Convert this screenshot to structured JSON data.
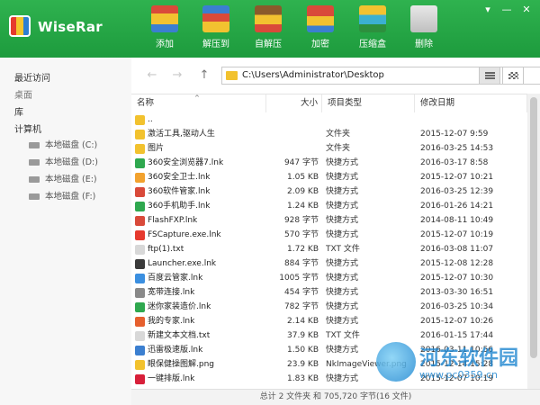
{
  "app": {
    "name": "WiseRar"
  },
  "toolbar": [
    {
      "label": "添加",
      "icon": "add-archive-icon"
    },
    {
      "label": "解压到",
      "icon": "extract-to-icon"
    },
    {
      "label": "自解压",
      "icon": "sfx-exe-icon"
    },
    {
      "label": "加密",
      "icon": "encrypt-icon"
    },
    {
      "label": "压缩盒",
      "icon": "archive-box-icon"
    },
    {
      "label": "删除",
      "icon": "trash-icon"
    }
  ],
  "window": {
    "menu": "▾",
    "minimize": "—",
    "close": "✕"
  },
  "sidebar": {
    "sections": [
      "最近访问",
      "桌面",
      "库",
      "计算机"
    ],
    "disks": [
      "本地磁盘 (C:)",
      "本地磁盘 (D:)",
      "本地磁盘 (E:)",
      "本地磁盘 (F:)"
    ]
  },
  "nav": {
    "back": "←",
    "forward": "→",
    "up": "↑",
    "path": "C:\\Users\\Administrator\\Desktop",
    "dropdown": "▼"
  },
  "columns": [
    "名称",
    "大小",
    "项目类型",
    "修改日期"
  ],
  "sort_arrow": "^",
  "files": [
    {
      "name": "..",
      "size": "",
      "type": "",
      "date": "",
      "color": "#f2c22e"
    },
    {
      "name": "激活工具,驱动人生",
      "size": "",
      "type": "文件夹",
      "date": "2015-12-07 9:59",
      "color": "#f2c22e"
    },
    {
      "name": "图片",
      "size": "",
      "type": "文件夹",
      "date": "2016-03-25 14:53",
      "color": "#f2c22e"
    },
    {
      "name": "360安全浏览器7.lnk",
      "size": "947 字节",
      "type": "快捷方式",
      "date": "2016-03-17 8:58",
      "color": "#2fa84f"
    },
    {
      "name": "360安全卫士.lnk",
      "size": "1.05 KB",
      "type": "快捷方式",
      "date": "2015-12-07 10:21",
      "color": "#f2a22e"
    },
    {
      "name": "360软件管家.lnk",
      "size": "2.09 KB",
      "type": "快捷方式",
      "date": "2016-03-25 12:39",
      "color": "#d94a3a"
    },
    {
      "name": "360手机助手.lnk",
      "size": "1.24 KB",
      "type": "快捷方式",
      "date": "2016-01-26 14:21",
      "color": "#2fa84f"
    },
    {
      "name": "FlashFXP.lnk",
      "size": "928 字节",
      "type": "快捷方式",
      "date": "2014-08-11 10:49",
      "color": "#d94a3a"
    },
    {
      "name": "FSCapture.exe.lnk",
      "size": "570 字节",
      "type": "快捷方式",
      "date": "2015-12-07 10:19",
      "color": "#e63a2e"
    },
    {
      "name": "ftp(1).txt",
      "size": "1.72 KB",
      "type": "TXT 文件",
      "date": "2016-03-08 11:07",
      "color": "#d8d8d8"
    },
    {
      "name": "Launcher.exe.lnk",
      "size": "884 字节",
      "type": "快捷方式",
      "date": "2015-12-08 12:28",
      "color": "#3b3b3b"
    },
    {
      "name": "百度云管家.lnk",
      "size": "1005 字节",
      "type": "快捷方式",
      "date": "2015-12-07 10:30",
      "color": "#3b8fe0"
    },
    {
      "name": "宽带连接.lnk",
      "size": "454 字节",
      "type": "快捷方式",
      "date": "2013-03-30 16:51",
      "color": "#8a8a8a"
    },
    {
      "name": "迷你家装造价.lnk",
      "size": "782 字节",
      "type": "快捷方式",
      "date": "2016-03-25 10:34",
      "color": "#2fa84f"
    },
    {
      "name": "我的专家.lnk",
      "size": "2.14 KB",
      "type": "快捷方式",
      "date": "2015-12-07 10:26",
      "color": "#e6602e"
    },
    {
      "name": "新建文本文档.txt",
      "size": "37.9 KB",
      "type": "TXT 文件",
      "date": "2016-01-15 17:44",
      "color": "#d8d8d8"
    },
    {
      "name": "迅雷极速版.lnk",
      "size": "1.50 KB",
      "type": "快捷方式",
      "date": "2016-03-11 10:56",
      "color": "#3b7fd0"
    },
    {
      "name": "眼保健操图解.png",
      "size": "23.9 KB",
      "type": "NkImageViewer.png",
      "date": "2015-12-14 15:28",
      "color": "#f2c22e"
    },
    {
      "name": "一键排版.lnk",
      "size": "1.83 KB",
      "type": "快捷方式",
      "date": "2015-12-07 10:19",
      "color": "#d8203a"
    }
  ],
  "status": "总计 2 文件夹 和 705,720 字节(16 文件)",
  "watermark": {
    "text": "河东软件园",
    "url": "www.pc0359.cn"
  }
}
